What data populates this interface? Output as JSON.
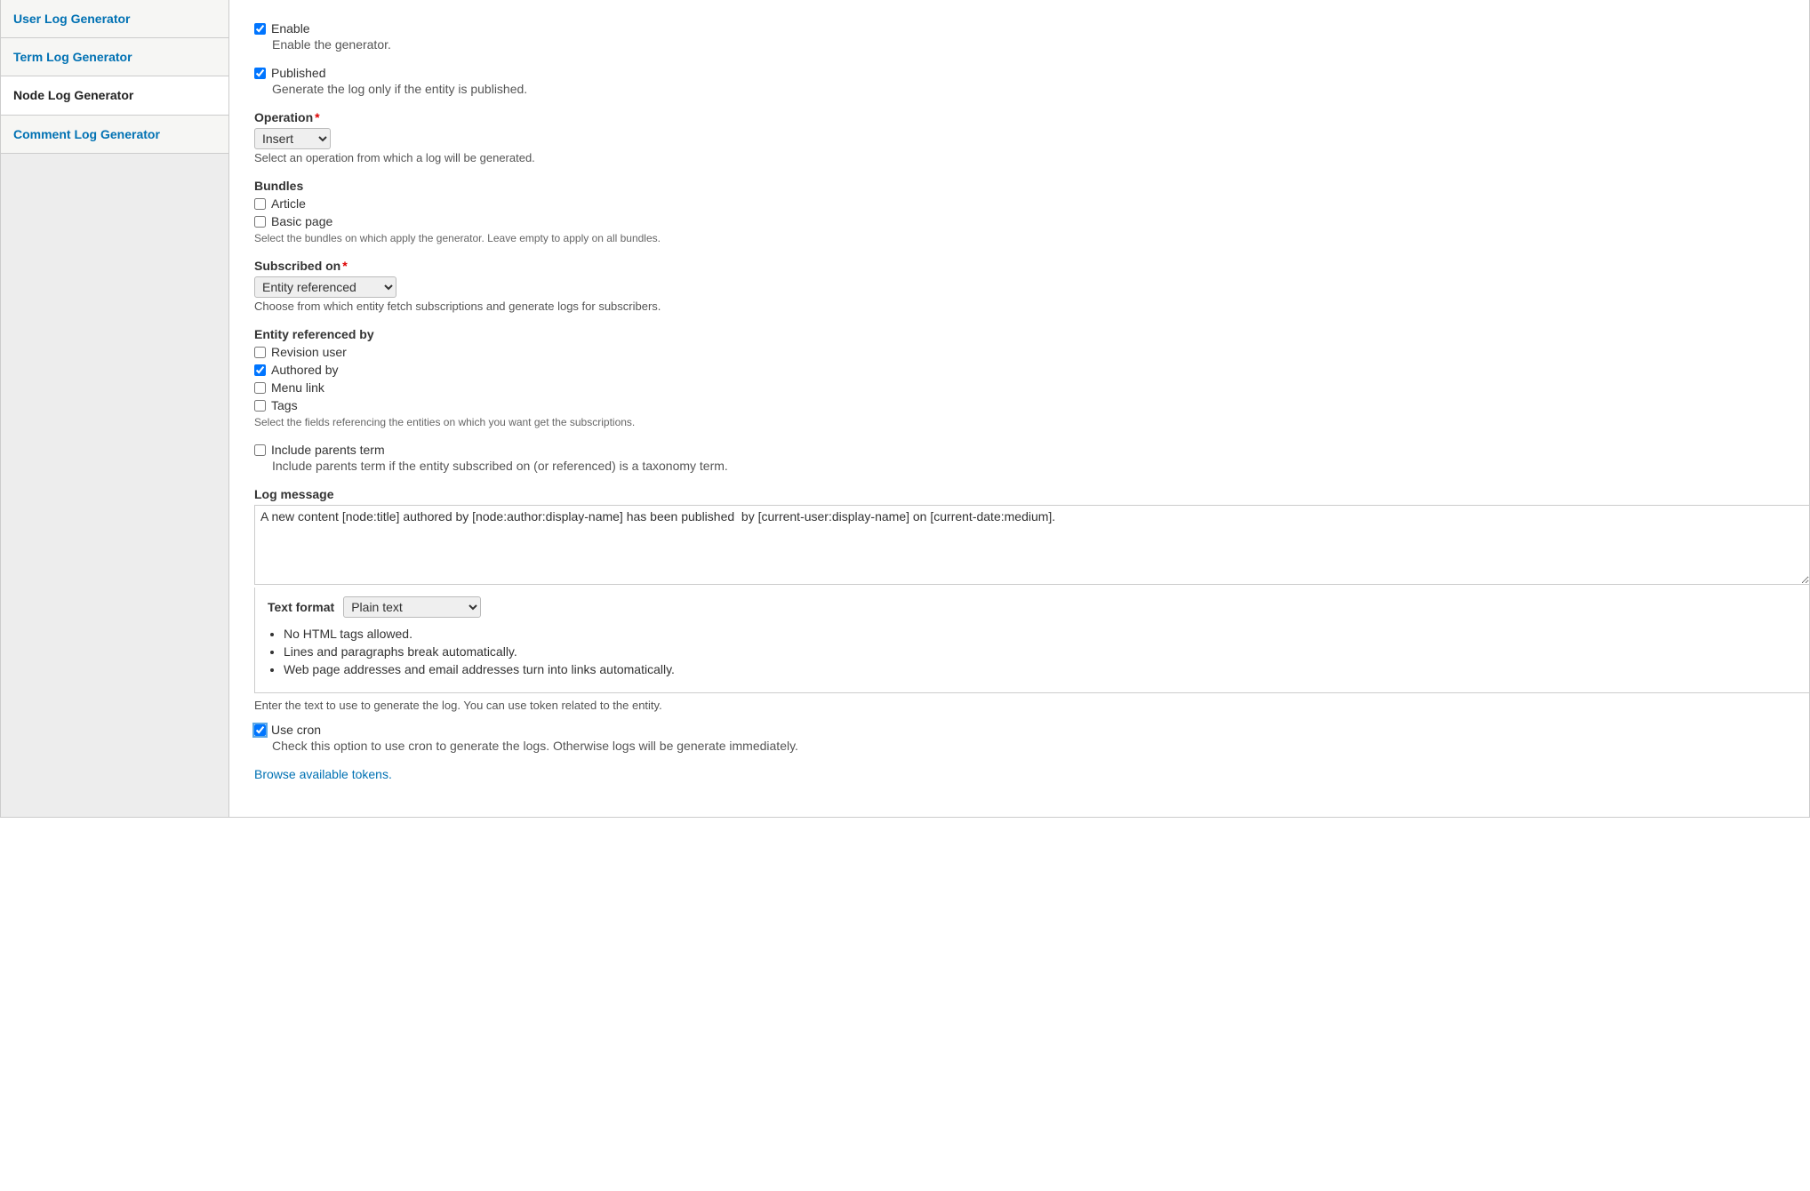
{
  "sidebar": {
    "items": [
      {
        "label": "User Log Generator",
        "active": false
      },
      {
        "label": "Term Log Generator",
        "active": false
      },
      {
        "label": "Node Log Generator",
        "active": true
      },
      {
        "label": "Comment Log Generator",
        "active": false
      }
    ]
  },
  "form": {
    "enable": {
      "label": "Enable",
      "checked": true,
      "desc": "Enable the generator."
    },
    "published": {
      "label": "Published",
      "checked": true,
      "desc": "Generate the log only if the entity is published."
    },
    "operation": {
      "label": "Operation",
      "required": true,
      "value": "Insert",
      "help": "Select an operation from which a log will be generated."
    },
    "bundles": {
      "label": "Bundles",
      "options": [
        {
          "label": "Article",
          "checked": false
        },
        {
          "label": "Basic page",
          "checked": false
        }
      ],
      "help": "Select the bundles on which apply the generator. Leave empty to apply on all bundles."
    },
    "subscribed_on": {
      "label": "Subscribed on",
      "required": true,
      "value": "Entity referenced",
      "help": "Choose from which entity fetch subscriptions and generate logs for subscribers."
    },
    "entity_ref": {
      "label": "Entity referenced by",
      "options": [
        {
          "label": "Revision user",
          "checked": false
        },
        {
          "label": "Authored by",
          "checked": true
        },
        {
          "label": "Menu link",
          "checked": false
        },
        {
          "label": "Tags",
          "checked": false
        }
      ],
      "help": "Select the fields referencing the entities on which you want get the subscriptions."
    },
    "include_parents": {
      "label": "Include parents term",
      "checked": false,
      "desc": "Include parents term if the entity subscribed on (or referenced) is a taxonomy term."
    },
    "log_message": {
      "label": "Log message",
      "value": "A new content [node:title] authored by [node:author:display-name] has been published  by [current-user:display-name] on [current-date:medium].",
      "help_after": "Enter the text to use to generate the log. You can use token related to the entity."
    },
    "text_format": {
      "label": "Text format",
      "value": "Plain text",
      "tips": [
        "No HTML tags allowed.",
        "Lines and paragraphs break automatically.",
        "Web page addresses and email addresses turn into links automatically."
      ]
    },
    "use_cron": {
      "label": "Use cron",
      "checked": true,
      "desc": "Check this option to use cron to generate the logs. Otherwise logs will be generate immediately."
    },
    "tokens_link": "Browse available tokens."
  }
}
